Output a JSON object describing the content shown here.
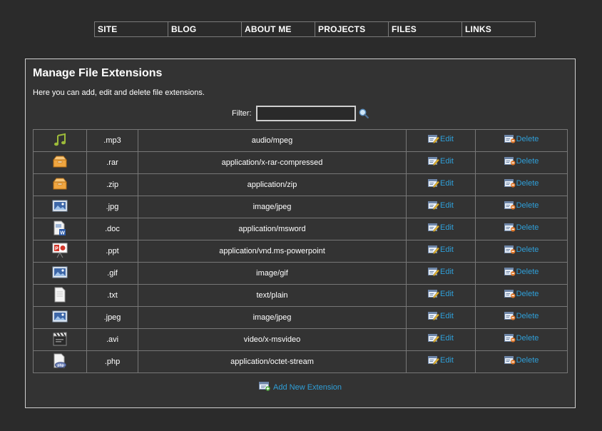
{
  "nav": [
    {
      "label": "SITE"
    },
    {
      "label": "BLOG"
    },
    {
      "label": "ABOUT ME"
    },
    {
      "label": "PROJECTS"
    },
    {
      "label": "FILES"
    },
    {
      "label": "LINKS"
    }
  ],
  "page": {
    "title": "Manage File Extensions",
    "description": "Here you can add, edit and delete file extensions."
  },
  "filter": {
    "label": "Filter:",
    "value": ""
  },
  "actions": {
    "edit_label": "Edit",
    "delete_label": "Delete",
    "add_label": "Add New Extension"
  },
  "colors": {
    "background": "#2b2b2b",
    "panel": "#333333",
    "link": "#2f9fd8"
  },
  "extensions": [
    {
      "icon": "music-note-icon",
      "ext": ".mp3",
      "mime": "audio/mpeg"
    },
    {
      "icon": "archive-box-icon",
      "ext": ".rar",
      "mime": "application/x-rar-compressed"
    },
    {
      "icon": "archive-box-icon",
      "ext": ".zip",
      "mime": "application/zip"
    },
    {
      "icon": "image-icon",
      "ext": ".jpg",
      "mime": "image/jpeg"
    },
    {
      "icon": "word-document-icon",
      "ext": ".doc",
      "mime": "application/msword"
    },
    {
      "icon": "powerpoint-icon",
      "ext": ".ppt",
      "mime": "application/vnd.ms-powerpoint"
    },
    {
      "icon": "image-icon",
      "ext": ".gif",
      "mime": "image/gif"
    },
    {
      "icon": "text-file-icon",
      "ext": ".txt",
      "mime": "text/plain"
    },
    {
      "icon": "image-icon",
      "ext": ".jpeg",
      "mime": "image/jpeg"
    },
    {
      "icon": "video-clapper-icon",
      "ext": ".avi",
      "mime": "video/x-msvideo"
    },
    {
      "icon": "php-file-icon",
      "ext": ".php",
      "mime": "application/octet-stream"
    }
  ]
}
